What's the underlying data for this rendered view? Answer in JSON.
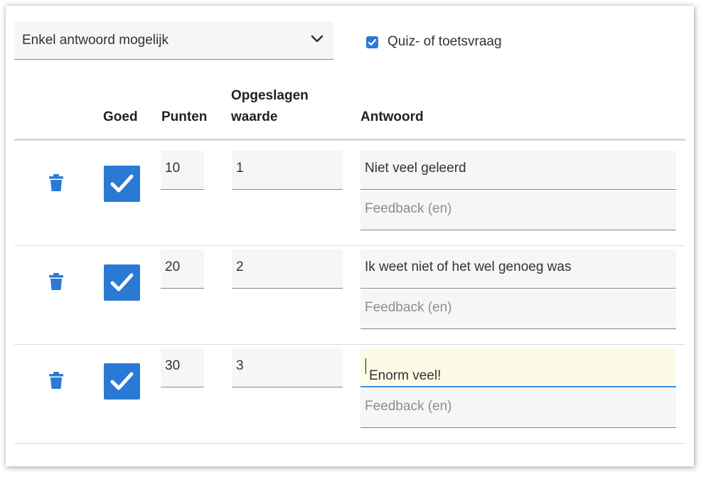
{
  "question_type": {
    "selected": "Enkel antwoord mogelijk"
  },
  "quiz_toggle": {
    "label": "Quiz- of toetsvraag",
    "checked": true
  },
  "columns": {
    "correct": "Goed",
    "points": "Punten",
    "stored_value_line1": "Opgeslagen",
    "stored_value_line2": "waarde",
    "answer": "Antwoord"
  },
  "answers": [
    {
      "correct": true,
      "points": "10",
      "stored_value": "1",
      "answer": "Niet veel geleerd",
      "feedback_placeholder": "Feedback (en)"
    },
    {
      "correct": true,
      "points": "20",
      "stored_value": "2",
      "answer": "Ik weet niet of het wel genoeg was",
      "feedback_placeholder": "Feedback (en)"
    },
    {
      "correct": true,
      "points": "30",
      "stored_value": "3",
      "answer": "Enorm veel!",
      "feedback_placeholder": "Feedback (en)"
    }
  ],
  "icons": {
    "delete": "trash-icon",
    "checked": "checkmark-icon",
    "dropdown": "chevron-down-icon"
  },
  "colors": {
    "accent": "#2a7ad5",
    "active_field_bg": "#fbfbe6",
    "active_field_border": "#3a8ee0",
    "field_bg": "#f6f6f6"
  }
}
